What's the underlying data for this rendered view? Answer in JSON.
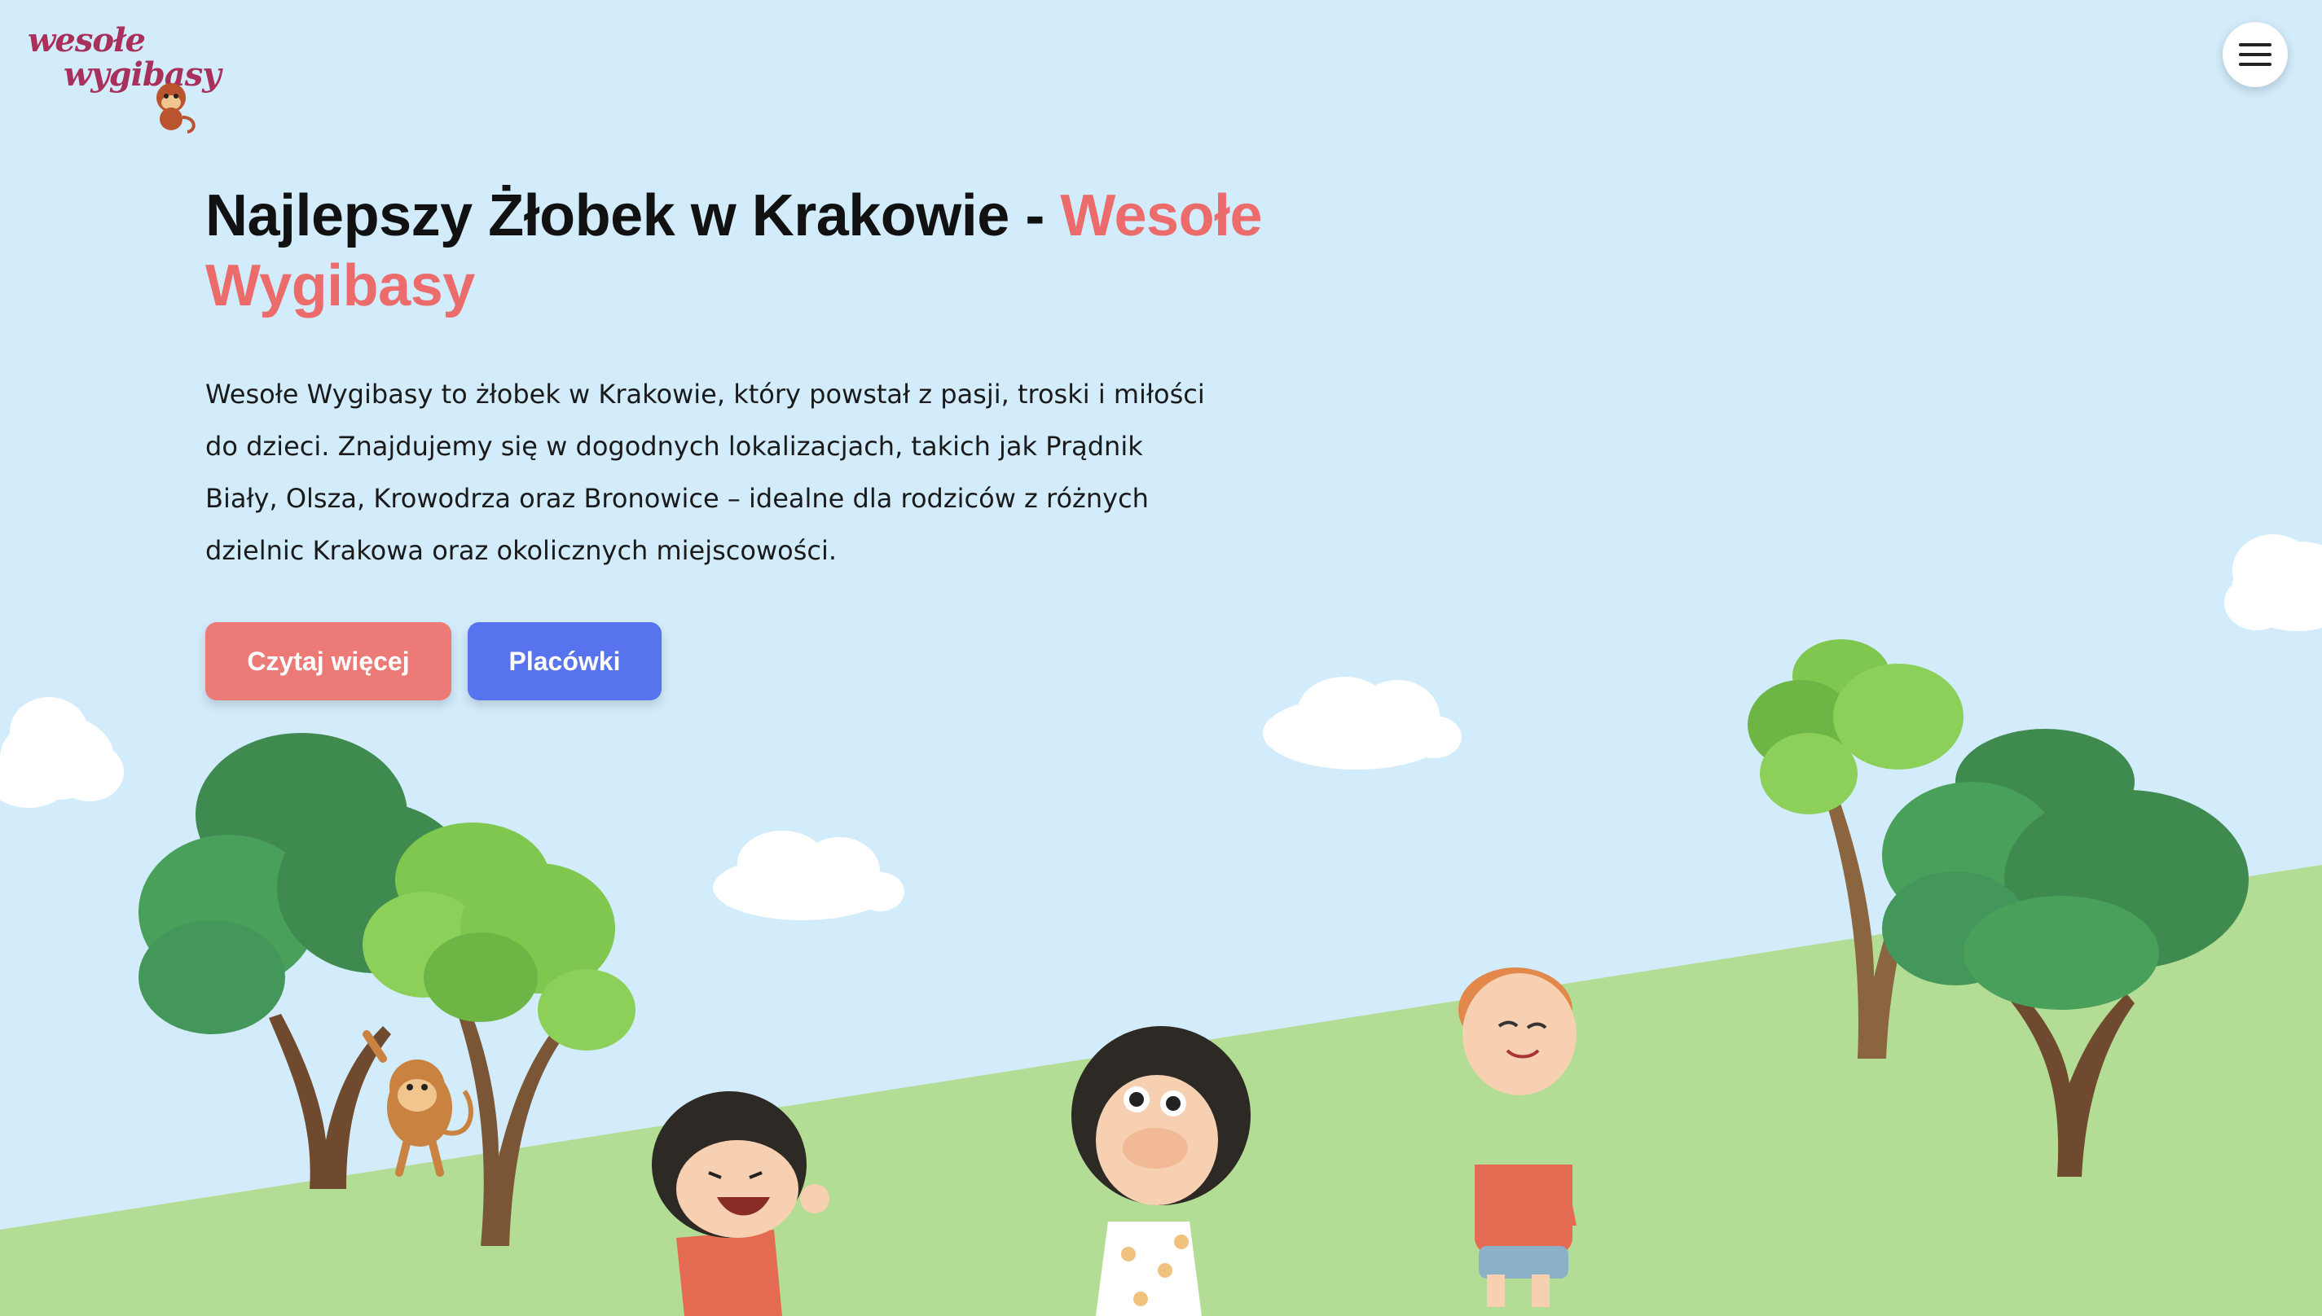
{
  "header": {
    "logo": {
      "line1": "wesołe",
      "line2": "wygibasy"
    },
    "menu_icon": "hamburger-menu-icon"
  },
  "hero": {
    "title_main": "Najlepszy Żłobek w Krakowie - ",
    "title_accent": "Wesołe Wygibasy",
    "description": "Wesołe Wygibasy to żłobek w Krakowie, który powstał z pasji, troski i miłości do dzieci. Znajdujemy się w dogodnych lokalizacjach, takich jak Prądnik Biały, Olsza, Krowodrza oraz Bronowice – idealne dla rodziców z różnych dzielnic Krakowa oraz okolicznych miejscowości.",
    "buttons": {
      "read_more": "Czytaj więcej",
      "locations": "Placówki"
    }
  },
  "colors": {
    "sky": "#d2ecfb",
    "grass": "#b3dd94",
    "accent_red": "#ec6b6b",
    "button_red": "#ec7b78",
    "button_blue": "#5773ee",
    "logo": "#a8305a"
  }
}
